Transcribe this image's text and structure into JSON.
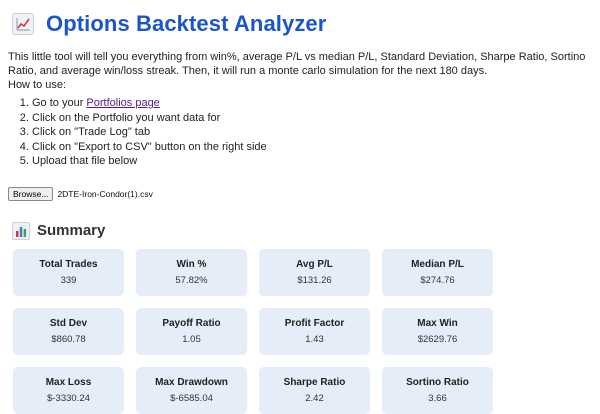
{
  "header": {
    "title": "Options Backtest Analyzer",
    "icon": "chart-increasing-icon"
  },
  "intro": {
    "text": "This little tool will tell you everything from win%, average P/L vs median P/L, Standard Deviation, Sharpe Ratio, Sortino Ratio, and average win/loss streak. Then, it will run a monte carlo simulation for the next 180 days.",
    "how_to": "How to use:"
  },
  "steps": {
    "s1_prefix": "Go to your ",
    "s1_link": "Portfolios page",
    "s2": "Click on the Portfolio you want data for",
    "s3": "Click on \"Trade Log\" tab",
    "s4": "Click on \"Export to CSV\" button on the right side",
    "s5": "Upload that file below"
  },
  "upload": {
    "button_label": "Browse...",
    "file_name": "2DTE-Iron-Condor(1).csv"
  },
  "summary": {
    "title": "Summary",
    "icon": "bar-chart-icon",
    "cards": [
      {
        "label": "Total Trades",
        "value": "339"
      },
      {
        "label": "Win %",
        "value": "57.82%"
      },
      {
        "label": "Avg P/L",
        "value": "$131.26"
      },
      {
        "label": "Median P/L",
        "value": "$274.76"
      },
      {
        "label": "Std Dev",
        "value": "$860.78"
      },
      {
        "label": "Payoff Ratio",
        "value": "1.05"
      },
      {
        "label": "Profit Factor",
        "value": "1.43"
      },
      {
        "label": "Max Win",
        "value": "$2629.76"
      },
      {
        "label": "Max Loss",
        "value": "$-3330.24"
      },
      {
        "label": "Max Drawdown",
        "value": "$-6585.04"
      },
      {
        "label": "Sharpe Ratio",
        "value": "2.42"
      },
      {
        "label": "Sortino Ratio",
        "value": "3.66"
      }
    ]
  },
  "colors": {
    "title": "#1a56c9",
    "card_bg": "#e5edf9",
    "link": "#551a8b"
  }
}
